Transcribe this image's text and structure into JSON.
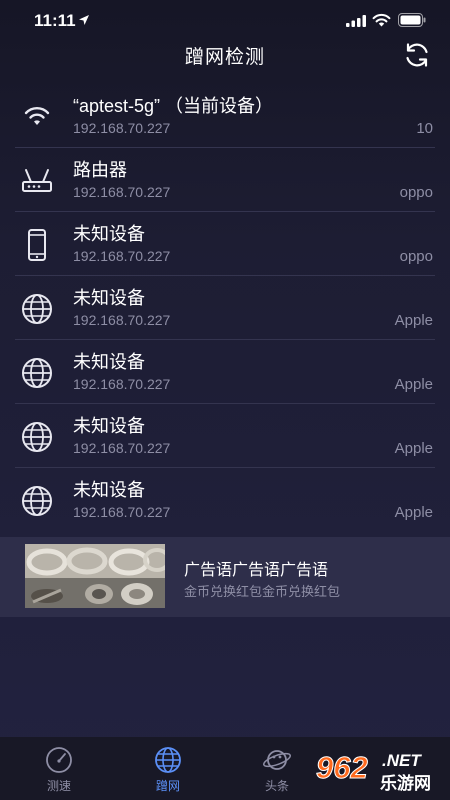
{
  "status_bar": {
    "time": "11:11"
  },
  "header": {
    "title": "蹭网检测"
  },
  "devices": [
    {
      "name": "“aptest-5g” （当前设备）",
      "ip": "192.168.70.227",
      "vendor": "10",
      "icon": "wifi-icon"
    },
    {
      "name": "路由器",
      "ip": "192.168.70.227",
      "vendor": "oppo",
      "icon": "router-icon"
    },
    {
      "name": "未知设备",
      "ip": "192.168.70.227",
      "vendor": "oppo",
      "icon": "phone-icon"
    },
    {
      "name": "未知设备",
      "ip": "192.168.70.227",
      "vendor": "Apple",
      "icon": "globe-icon"
    },
    {
      "name": "未知设备",
      "ip": "192.168.70.227",
      "vendor": "Apple",
      "icon": "globe-icon"
    },
    {
      "name": "未知设备",
      "ip": "192.168.70.227",
      "vendor": "Apple",
      "icon": "globe-icon"
    },
    {
      "name": "未知设备",
      "ip": "192.168.70.227",
      "vendor": "Apple",
      "icon": "globe-icon"
    }
  ],
  "ad": {
    "title": "广告语广告语广告语",
    "subtitle": "金币兑换红包金币兑换红包"
  },
  "tabs": [
    {
      "label": "测速",
      "icon": "speedometer-icon",
      "active": false
    },
    {
      "label": "蹭网",
      "icon": "globe-icon",
      "active": true
    },
    {
      "label": "头条",
      "icon": "planet-icon",
      "active": false
    }
  ],
  "watermark": {
    "number": "962",
    "net": ".NET",
    "site": "乐游网"
  },
  "colors": {
    "accent": "#5b8ff6",
    "background": "#1d1d33",
    "muted_text": "#8e8ea5"
  }
}
